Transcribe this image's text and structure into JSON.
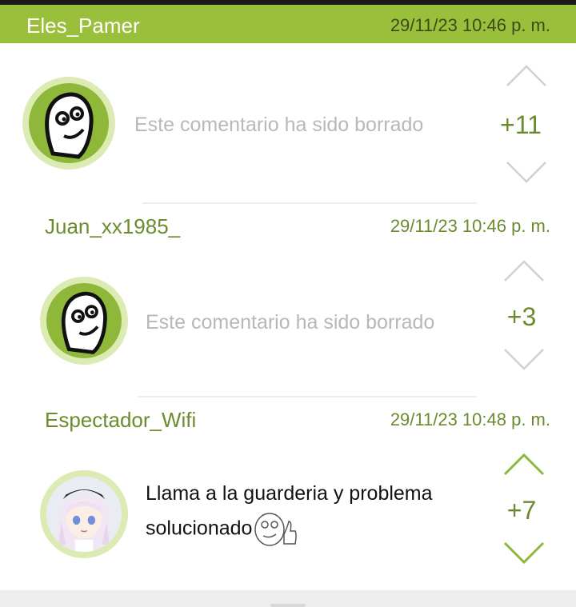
{
  "comments": [
    {
      "username": "Eles_Pamer",
      "timestamp": "29/11/23 10:46 p. m.",
      "text": "Este comentario ha sido borrado",
      "deleted": true,
      "score": "+11",
      "avatar_icon": "troll-face-icon"
    },
    {
      "username": "Juan_xx1985_",
      "timestamp": "29/11/23 10:46 p. m.",
      "text": "Este comentario ha sido borrado",
      "deleted": true,
      "score": "+3",
      "avatar_icon": "troll-face-icon"
    },
    {
      "username": "Espectador_Wifi",
      "timestamp": "29/11/23 10:48 p. m.",
      "text_line1": "Llama a la guarderia y problema",
      "text_line2": "solucionado",
      "deleted": false,
      "score": "+7",
      "avatar_icon": "anime-girl-avatar",
      "emoji": "thumbs-up-meme-face-icon"
    }
  ],
  "colors": {
    "accent": "#9abf3a",
    "accent_text": "#6c8b2f",
    "deleted_text": "#b8b8b8",
    "chevron_muted": "#d0d0d0"
  }
}
